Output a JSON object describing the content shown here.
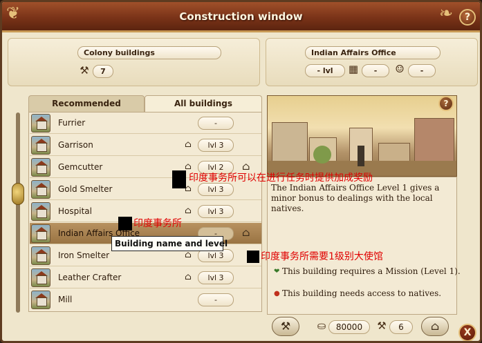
{
  "window": {
    "title": "Construction window",
    "help_label": "?",
    "close_label": "X"
  },
  "colony_panel": {
    "title": "Colony buildings",
    "hammer_count": "7"
  },
  "selected_panel": {
    "title": "Indian Affairs Office",
    "level": "- lvl",
    "stat_a": "-",
    "stat_b": "-"
  },
  "tabs": [
    {
      "label": "Recommended",
      "active": false
    },
    {
      "label": "All buildings",
      "active": true
    }
  ],
  "buildings": [
    {
      "name": "Furrier",
      "level": "-",
      "mini_icon": false,
      "side_icon": false,
      "selected": false
    },
    {
      "name": "Garrison",
      "level": "lvl 3",
      "mini_icon": true,
      "side_icon": false,
      "selected": false
    },
    {
      "name": "Gemcutter",
      "level": "lvl 2",
      "mini_icon": true,
      "side_icon": true,
      "selected": false
    },
    {
      "name": "Gold Smelter",
      "level": "lvl 3",
      "mini_icon": true,
      "side_icon": false,
      "selected": false
    },
    {
      "name": "Hospital",
      "level": "lvl 3",
      "mini_icon": true,
      "side_icon": false,
      "selected": false
    },
    {
      "name": "Indian Affairs Office",
      "level": "-",
      "mini_icon": false,
      "side_icon": true,
      "selected": true
    },
    {
      "name": "Iron Smelter",
      "level": "lvl 3",
      "mini_icon": true,
      "side_icon": false,
      "selected": false
    },
    {
      "name": "Leather Crafter",
      "level": "lvl 3",
      "mini_icon": true,
      "side_icon": false,
      "selected": false
    },
    {
      "name": "Mill",
      "level": "-",
      "mini_icon": false,
      "side_icon": false,
      "selected": false
    }
  ],
  "tooltip": "Building name and level",
  "detail": {
    "description": "The Indian Affairs Office Level 1 gives a minor bonus to dealings with the local natives.",
    "requirements": [
      "This building requires a Mission (Level 1).",
      "This building needs access to natives."
    ]
  },
  "costs": {
    "gold": "80000",
    "hammers": "6"
  },
  "annotations": {
    "note1": "印度事务所可以在进行任务时提供加成奖励",
    "note2": "印度事务所",
    "note3": "印度事务所需要1级别大使馆"
  },
  "colors": {
    "title_bar": "#7a3318",
    "panel_bg": "#efe6cc",
    "selected_row": "#a77f4d",
    "annotation_red": "#e00000"
  }
}
